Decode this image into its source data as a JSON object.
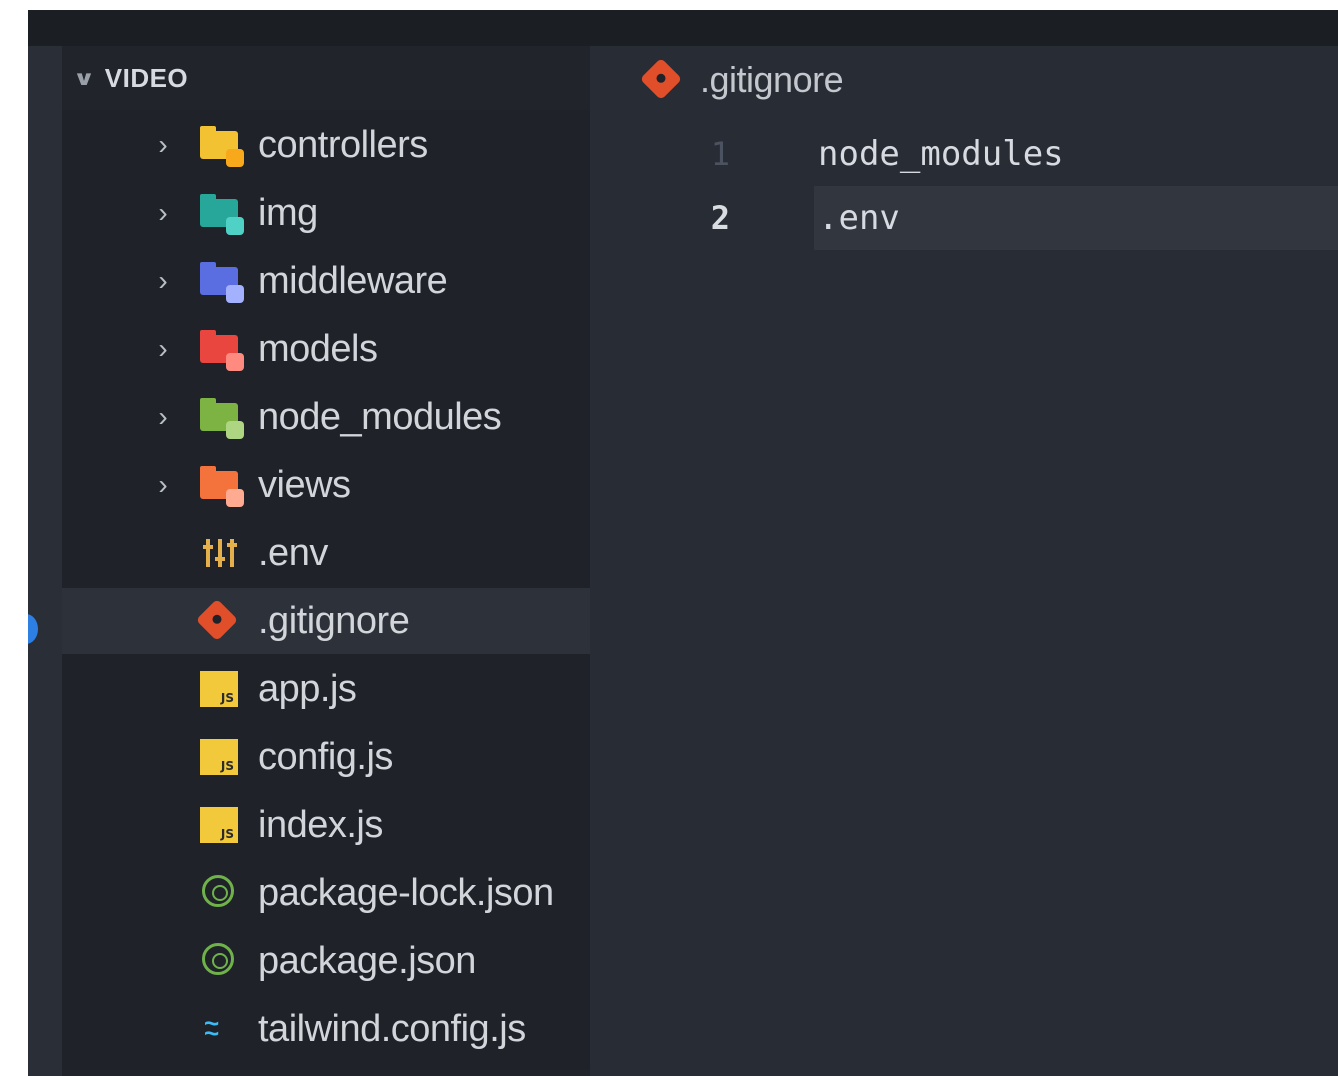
{
  "explorer": {
    "section_title": "VIDEO",
    "items": [
      {
        "label": "controllers",
        "kind": "folder",
        "icon": "folder-controllers-icon",
        "color": "#f2c233",
        "badge": "#f7a81b"
      },
      {
        "label": "img",
        "kind": "folder",
        "icon": "folder-images-icon",
        "color": "#27a69a",
        "badge": "#4fd1c5"
      },
      {
        "label": "middleware",
        "kind": "folder",
        "icon": "folder-middleware-icon",
        "color": "#5b6ee1",
        "badge": "#a3b1ff"
      },
      {
        "label": "models",
        "kind": "folder",
        "icon": "folder-models-icon",
        "color": "#e9463f",
        "badge": "#ff8a80"
      },
      {
        "label": "node_modules",
        "kind": "folder",
        "icon": "folder-node-icon",
        "color": "#7cb342",
        "badge": "#aed581"
      },
      {
        "label": "views",
        "kind": "folder",
        "icon": "folder-views-icon",
        "color": "#f4733c",
        "badge": "#ffab91"
      },
      {
        "label": ".env",
        "kind": "file",
        "icon": "env-settings-icon"
      },
      {
        "label": ".gitignore",
        "kind": "file",
        "icon": "git-icon",
        "selected": true
      },
      {
        "label": "app.js",
        "kind": "file",
        "icon": "javascript-icon"
      },
      {
        "label": "config.js",
        "kind": "file",
        "icon": "javascript-icon"
      },
      {
        "label": "index.js",
        "kind": "file",
        "icon": "javascript-icon"
      },
      {
        "label": "package-lock.json",
        "kind": "file",
        "icon": "npm-icon"
      },
      {
        "label": "package.json",
        "kind": "file",
        "icon": "npm-icon"
      },
      {
        "label": "tailwind.config.js",
        "kind": "file",
        "icon": "tailwind-icon"
      }
    ]
  },
  "editor": {
    "tab_title": ".gitignore",
    "tab_icon": "git-icon",
    "lines": [
      {
        "number": "1",
        "text": "node_modules"
      },
      {
        "number": "2",
        "text": ".env",
        "current": true
      }
    ]
  },
  "colors": {
    "accent": "#2d7fe3",
    "git": "#e04e2a",
    "js": "#f2c93b",
    "npm": "#6fb24a",
    "tailwind": "#38bdf8"
  }
}
